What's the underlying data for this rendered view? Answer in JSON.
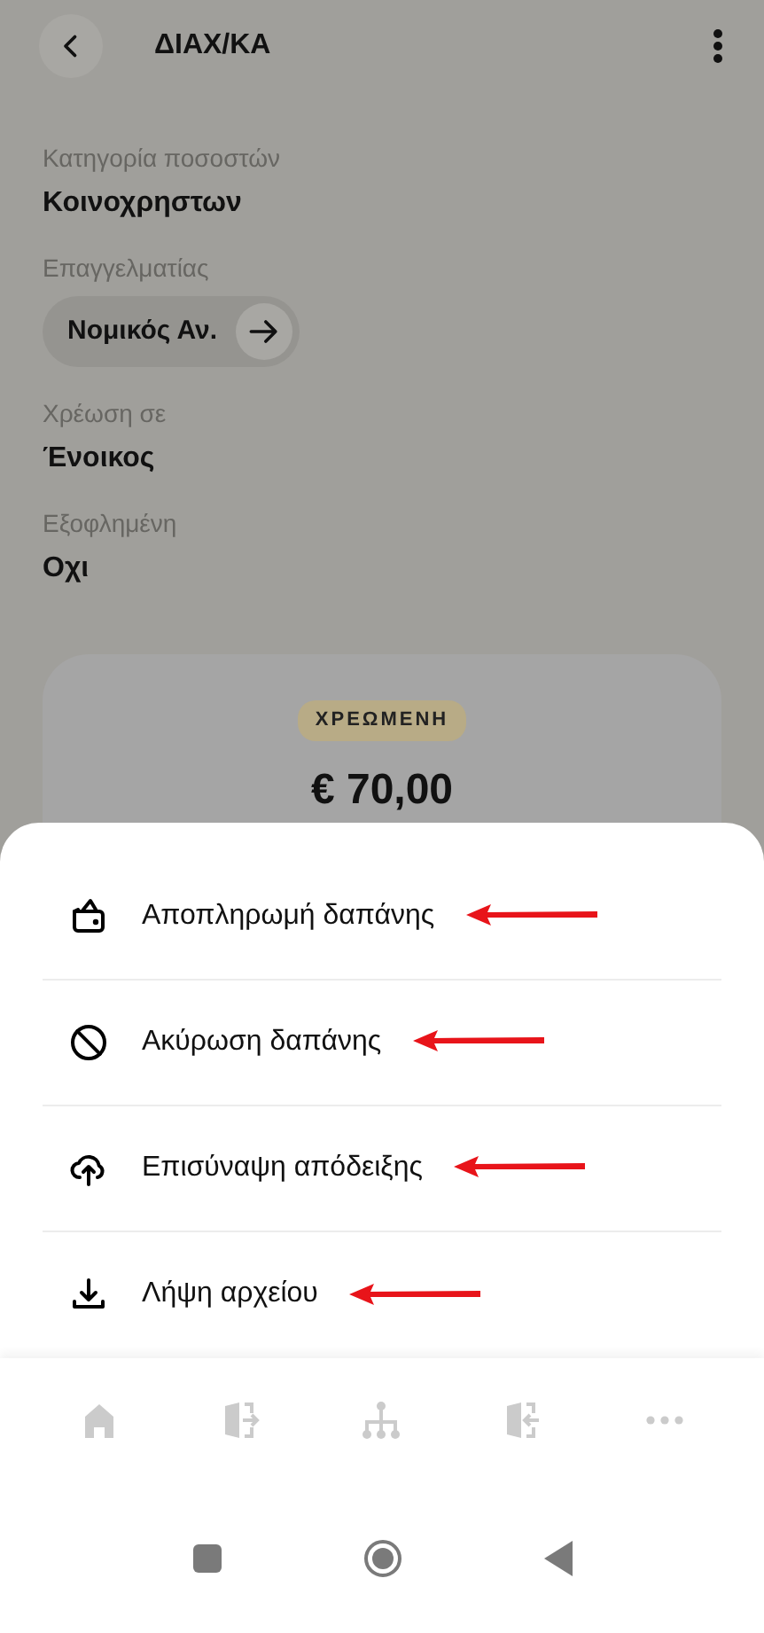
{
  "header": {
    "title": "ΔΙΑΧ/ΚΑ"
  },
  "fields": [
    {
      "kind": "text",
      "label": "Κατηγορία ποσοστών",
      "value": "Κοινοχρηστων"
    },
    {
      "kind": "chip",
      "label": "Επαγγελματίας",
      "value": "Νομικός Αν."
    },
    {
      "kind": "text",
      "label": "Χρέωση σε",
      "value": "Ένοικος"
    },
    {
      "kind": "text",
      "label": "Εξοφλημένη",
      "value": "Οχι"
    }
  ],
  "summary": {
    "status": "ΧΡΕΩΜΕΝΗ",
    "amount": "€ 70,00"
  },
  "actions": [
    {
      "kind": "pay",
      "label": "Αποπληρωμή δαπάνης",
      "marked": true
    },
    {
      "kind": "cancel",
      "label": "Ακύρωση δαπάνης",
      "marked": true
    },
    {
      "kind": "upload",
      "label": "Επισύναψη απόδειξης",
      "marked": true
    },
    {
      "kind": "download",
      "label": "Λήψη αρχείου",
      "marked": true
    }
  ],
  "bottom_nav": [
    {
      "kind": "home"
    },
    {
      "kind": "exit"
    },
    {
      "kind": "tree"
    },
    {
      "kind": "enter"
    },
    {
      "kind": "more"
    }
  ]
}
